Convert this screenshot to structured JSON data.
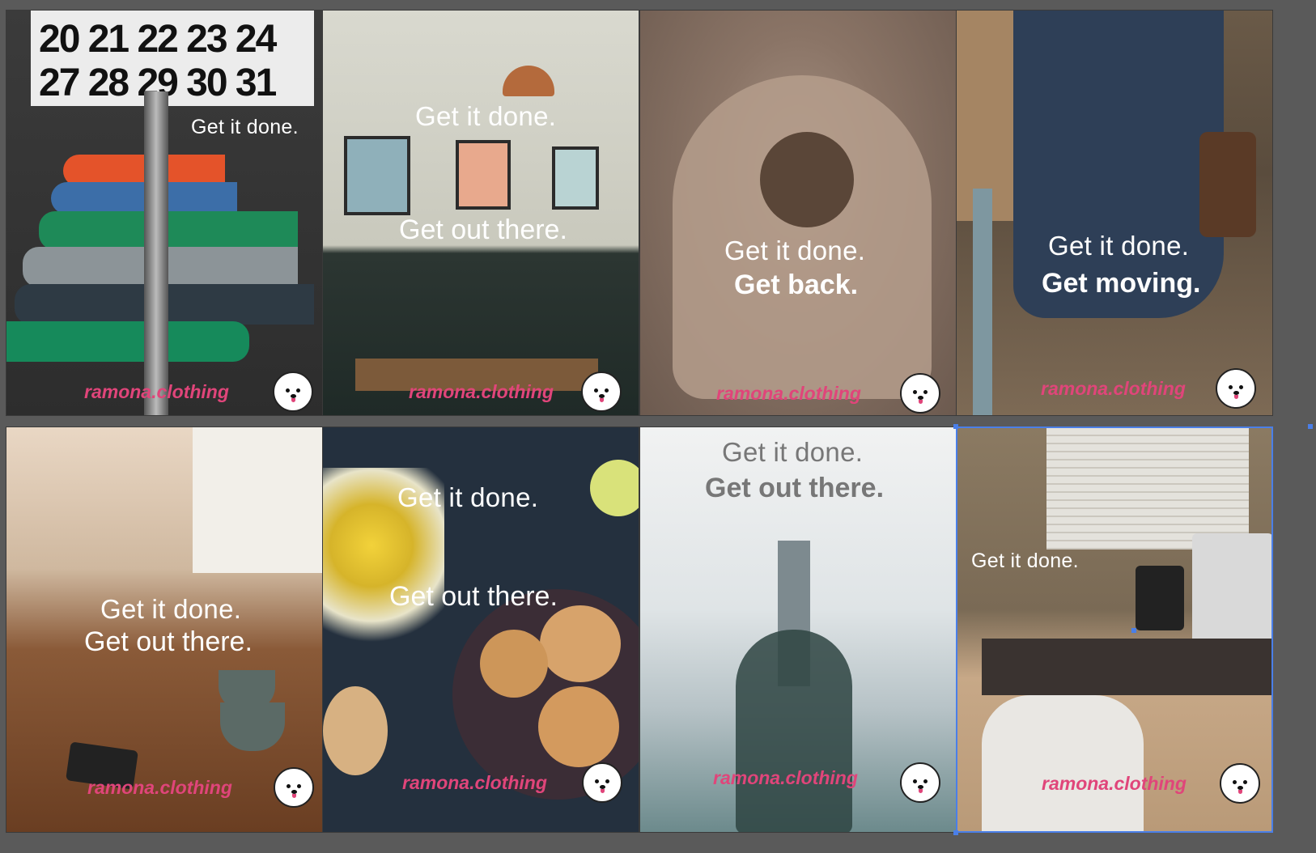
{
  "cards": [
    {
      "line1": "Get it done.",
      "line2": "",
      "brand": "ramona.clothing",
      "calendar_row1": "20 21 22 23 24",
      "calendar_row2": "27 28 29 30 31"
    },
    {
      "line1": "Get it done.",
      "line2": "Get out there.",
      "brand": "ramona.clothing"
    },
    {
      "line1": "Get it done.",
      "line2": "Get back.",
      "brand": "ramona.clothing"
    },
    {
      "line1": "Get it done.",
      "line2": "Get moving.",
      "brand": "ramona.clothing"
    },
    {
      "line1": "Get it done.",
      "line2": "Get out there.",
      "brand": "ramona.clothing"
    },
    {
      "line1": "Get it done.",
      "line2": "Get out there.",
      "brand": "ramona.clothing"
    },
    {
      "line1": "Get it done.",
      "line2": "Get out there.",
      "brand": "ramona.clothing"
    },
    {
      "line1": "Get it done.",
      "line2": "",
      "brand": "ramona.clothing"
    }
  ],
  "logo_icon": "dog-face-icon",
  "colors": {
    "brand": "#e0457a",
    "selection": "#4a7fe8",
    "canvas": "#5a5a5a"
  }
}
